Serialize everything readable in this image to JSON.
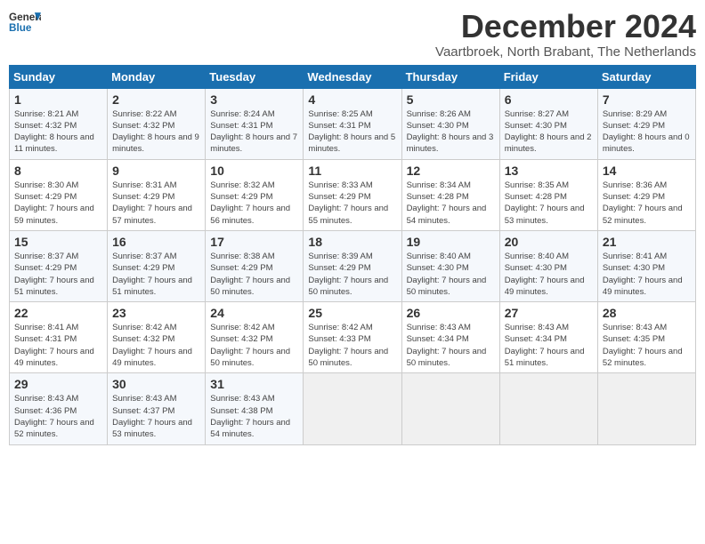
{
  "header": {
    "logo_line1": "General",
    "logo_line2": "Blue",
    "title": "December 2024",
    "subtitle": "Vaartbroek, North Brabant, The Netherlands"
  },
  "weekdays": [
    "Sunday",
    "Monday",
    "Tuesday",
    "Wednesday",
    "Thursday",
    "Friday",
    "Saturday"
  ],
  "weeks": [
    [
      {
        "day": "1",
        "sunrise": "8:21 AM",
        "sunset": "4:32 PM",
        "daylight": "8 hours and 11 minutes."
      },
      {
        "day": "2",
        "sunrise": "8:22 AM",
        "sunset": "4:32 PM",
        "daylight": "8 hours and 9 minutes."
      },
      {
        "day": "3",
        "sunrise": "8:24 AM",
        "sunset": "4:31 PM",
        "daylight": "8 hours and 7 minutes."
      },
      {
        "day": "4",
        "sunrise": "8:25 AM",
        "sunset": "4:31 PM",
        "daylight": "8 hours and 5 minutes."
      },
      {
        "day": "5",
        "sunrise": "8:26 AM",
        "sunset": "4:30 PM",
        "daylight": "8 hours and 3 minutes."
      },
      {
        "day": "6",
        "sunrise": "8:27 AM",
        "sunset": "4:30 PM",
        "daylight": "8 hours and 2 minutes."
      },
      {
        "day": "7",
        "sunrise": "8:29 AM",
        "sunset": "4:29 PM",
        "daylight": "8 hours and 0 minutes."
      }
    ],
    [
      {
        "day": "8",
        "sunrise": "8:30 AM",
        "sunset": "4:29 PM",
        "daylight": "7 hours and 59 minutes."
      },
      {
        "day": "9",
        "sunrise": "8:31 AM",
        "sunset": "4:29 PM",
        "daylight": "7 hours and 57 minutes."
      },
      {
        "day": "10",
        "sunrise": "8:32 AM",
        "sunset": "4:29 PM",
        "daylight": "7 hours and 56 minutes."
      },
      {
        "day": "11",
        "sunrise": "8:33 AM",
        "sunset": "4:29 PM",
        "daylight": "7 hours and 55 minutes."
      },
      {
        "day": "12",
        "sunrise": "8:34 AM",
        "sunset": "4:28 PM",
        "daylight": "7 hours and 54 minutes."
      },
      {
        "day": "13",
        "sunrise": "8:35 AM",
        "sunset": "4:28 PM",
        "daylight": "7 hours and 53 minutes."
      },
      {
        "day": "14",
        "sunrise": "8:36 AM",
        "sunset": "4:29 PM",
        "daylight": "7 hours and 52 minutes."
      }
    ],
    [
      {
        "day": "15",
        "sunrise": "8:37 AM",
        "sunset": "4:29 PM",
        "daylight": "7 hours and 51 minutes."
      },
      {
        "day": "16",
        "sunrise": "8:37 AM",
        "sunset": "4:29 PM",
        "daylight": "7 hours and 51 minutes."
      },
      {
        "day": "17",
        "sunrise": "8:38 AM",
        "sunset": "4:29 PM",
        "daylight": "7 hours and 50 minutes."
      },
      {
        "day": "18",
        "sunrise": "8:39 AM",
        "sunset": "4:29 PM",
        "daylight": "7 hours and 50 minutes."
      },
      {
        "day": "19",
        "sunrise": "8:40 AM",
        "sunset": "4:30 PM",
        "daylight": "7 hours and 50 minutes."
      },
      {
        "day": "20",
        "sunrise": "8:40 AM",
        "sunset": "4:30 PM",
        "daylight": "7 hours and 49 minutes."
      },
      {
        "day": "21",
        "sunrise": "8:41 AM",
        "sunset": "4:30 PM",
        "daylight": "7 hours and 49 minutes."
      }
    ],
    [
      {
        "day": "22",
        "sunrise": "8:41 AM",
        "sunset": "4:31 PM",
        "daylight": "7 hours and 49 minutes."
      },
      {
        "day": "23",
        "sunrise": "8:42 AM",
        "sunset": "4:32 PM",
        "daylight": "7 hours and 49 minutes."
      },
      {
        "day": "24",
        "sunrise": "8:42 AM",
        "sunset": "4:32 PM",
        "daylight": "7 hours and 50 minutes."
      },
      {
        "day": "25",
        "sunrise": "8:42 AM",
        "sunset": "4:33 PM",
        "daylight": "7 hours and 50 minutes."
      },
      {
        "day": "26",
        "sunrise": "8:43 AM",
        "sunset": "4:34 PM",
        "daylight": "7 hours and 50 minutes."
      },
      {
        "day": "27",
        "sunrise": "8:43 AM",
        "sunset": "4:34 PM",
        "daylight": "7 hours and 51 minutes."
      },
      {
        "day": "28",
        "sunrise": "8:43 AM",
        "sunset": "4:35 PM",
        "daylight": "7 hours and 52 minutes."
      }
    ],
    [
      {
        "day": "29",
        "sunrise": "8:43 AM",
        "sunset": "4:36 PM",
        "daylight": "7 hours and 52 minutes."
      },
      {
        "day": "30",
        "sunrise": "8:43 AM",
        "sunset": "4:37 PM",
        "daylight": "7 hours and 53 minutes."
      },
      {
        "day": "31",
        "sunrise": "8:43 AM",
        "sunset": "4:38 PM",
        "daylight": "7 hours and 54 minutes."
      },
      null,
      null,
      null,
      null
    ]
  ]
}
